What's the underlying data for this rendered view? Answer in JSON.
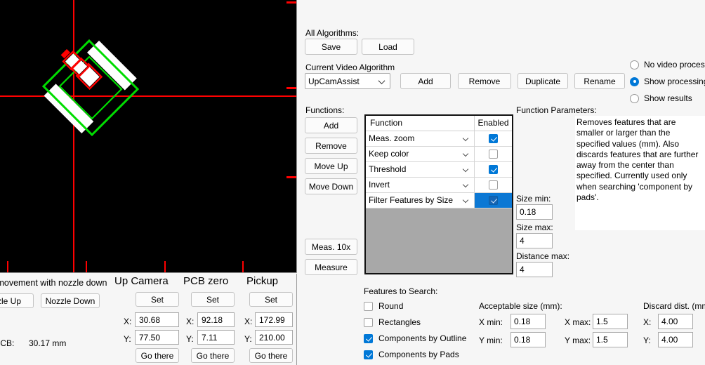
{
  "camera": {
    "name": "up-camera-live-view",
    "crosshair_color": "#ff0000",
    "outline_color": "#00d400",
    "feature_box_color": "#ff0000",
    "background": "#000000"
  },
  "all_algorithms": {
    "label": "All Algorithms:",
    "save_label": "Save",
    "load_label": "Load"
  },
  "current_algorithm": {
    "label": "Current Video Algorithm",
    "value": "UpCamAssist",
    "add_label": "Add",
    "remove_label": "Remove",
    "duplicate_label": "Duplicate",
    "rename_label": "Rename"
  },
  "video_mode": {
    "options": [
      "No video processing",
      "Show processing",
      "Show results"
    ],
    "selected": "Show processing"
  },
  "functions": {
    "label": "Functions:",
    "buttons": [
      "Add",
      "Remove",
      "Move Up",
      "Move Down"
    ],
    "meas10x_label": "Meas. 10x",
    "measure_label": "Measure",
    "grid": {
      "headers": [
        "Function",
        "Enabled"
      ],
      "rows": [
        {
          "name": "Meas. zoom",
          "enabled": true,
          "selected": false
        },
        {
          "name": "Keep color",
          "enabled": false,
          "selected": false
        },
        {
          "name": "Threshold",
          "enabled": true,
          "selected": false
        },
        {
          "name": "Invert",
          "enabled": false,
          "selected": false
        },
        {
          "name": "Filter Features by Size",
          "enabled": true,
          "selected": true
        }
      ]
    }
  },
  "function_parameters": {
    "label": "Function Parameters:",
    "description": "Removes features that are smaller or larger than  the specified values (mm). Also discards features that are further away from the center than specified. Currently used only when searching 'component by pads'.",
    "size_min_label": "Size min:",
    "size_min_value": "0.18",
    "size_max_label": "Size max:",
    "size_max_value": "4",
    "distance_max_label": "Distance max:",
    "distance_max_value": "4"
  },
  "features_to_search": {
    "label": "Features to Search:",
    "items": [
      {
        "label": "Round",
        "checked": false
      },
      {
        "label": "Rectangles",
        "checked": false
      },
      {
        "label": "Components by Outline",
        "checked": true
      },
      {
        "label": "Components by Pads",
        "checked": true
      }
    ]
  },
  "acceptable_size": {
    "label": "Acceptable size (mm):",
    "x_min_label": "X min:",
    "x_min_value": "0.18",
    "y_min_label": "Y min:",
    "y_min_value": "0.18",
    "x_max_label": "X max:",
    "x_max_value": "1.5",
    "y_max_label": "Y max:",
    "y_max_value": "1.5"
  },
  "discard_dist": {
    "label": "Discard dist. (mm):",
    "x_label": "X:",
    "x_value": "4.00",
    "y_label": "Y:",
    "y_value": "4.00"
  },
  "nozzle": {
    "movement_label": "ow movement with nozzle down",
    "up_label": "zzle Up",
    "down_label": "Nozzle Down",
    "to_pcb_label": "to PCB:",
    "to_pcb_value": "30.17 mm"
  },
  "positions": [
    {
      "title": "Up Camera",
      "set_label": "Set",
      "x_label": "X:",
      "x_value": "30.68",
      "y_label": "Y:",
      "y_value": "77.50",
      "go_label": "Go there"
    },
    {
      "title": "PCB zero",
      "set_label": "Set",
      "x_label": "X:",
      "x_value": "92.18",
      "y_label": "Y:",
      "y_value": "7.11",
      "go_label": "Go there"
    },
    {
      "title": "Pickup",
      "set_label": "Set",
      "x_label": "X:",
      "x_value": "172.99",
      "y_label": "Y:",
      "y_value": "210.00",
      "go_label": "Go there"
    }
  ]
}
